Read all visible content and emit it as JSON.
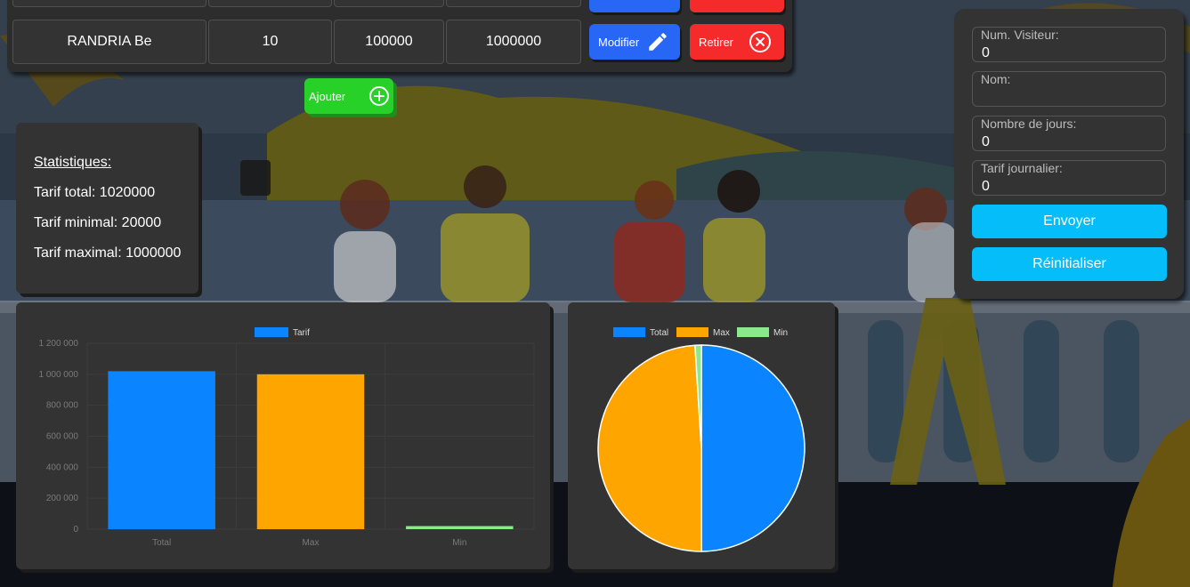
{
  "table": {
    "row": {
      "name": "RANDRIA Be",
      "days": "10",
      "daily_rate": "100000",
      "total": "1000000"
    },
    "modify_label": "Modifier",
    "remove_label": "Retirer"
  },
  "add_label": "Ajouter",
  "stats": {
    "title": "Statistiques:",
    "total": "Tarif total: 1020000",
    "min": "Tarif minimal: 20000",
    "max": "Tarif maximal: 1000000"
  },
  "form": {
    "visitor_number": {
      "label": "Num. Visiteur:",
      "value": "0"
    },
    "name": {
      "label": "Nom:",
      "value": ""
    },
    "days": {
      "label": "Nombre de jours:",
      "value": "0"
    },
    "daily_rate": {
      "label": "Tarif journalier:",
      "value": "0"
    },
    "submit_label": "Envoyer",
    "reset_label": "Réinitialiser"
  },
  "colors": {
    "total": "#0a84ff",
    "max": "#ffa500",
    "min": "#8ce88c",
    "modify": "#2866f5",
    "remove": "#f52a2a",
    "add": "#27d127",
    "submit": "#05bdf8"
  },
  "chart_data": [
    {
      "type": "bar",
      "categories": [
        "Total",
        "Max",
        "Min"
      ],
      "series": [
        {
          "name": "Tarif",
          "values": [
            1020000,
            1000000,
            20000
          ]
        }
      ],
      "ylim": [
        0,
        1200000
      ],
      "yticks": [
        "0",
        "200 000",
        "400 000",
        "600 000",
        "800 000",
        "1 000 000",
        "1 200 000"
      ],
      "legend": "top",
      "grid": true
    },
    {
      "type": "pie",
      "labels": [
        "Total",
        "Max",
        "Min"
      ],
      "values": [
        1020000,
        1000000,
        20000
      ],
      "legend": "top"
    }
  ]
}
